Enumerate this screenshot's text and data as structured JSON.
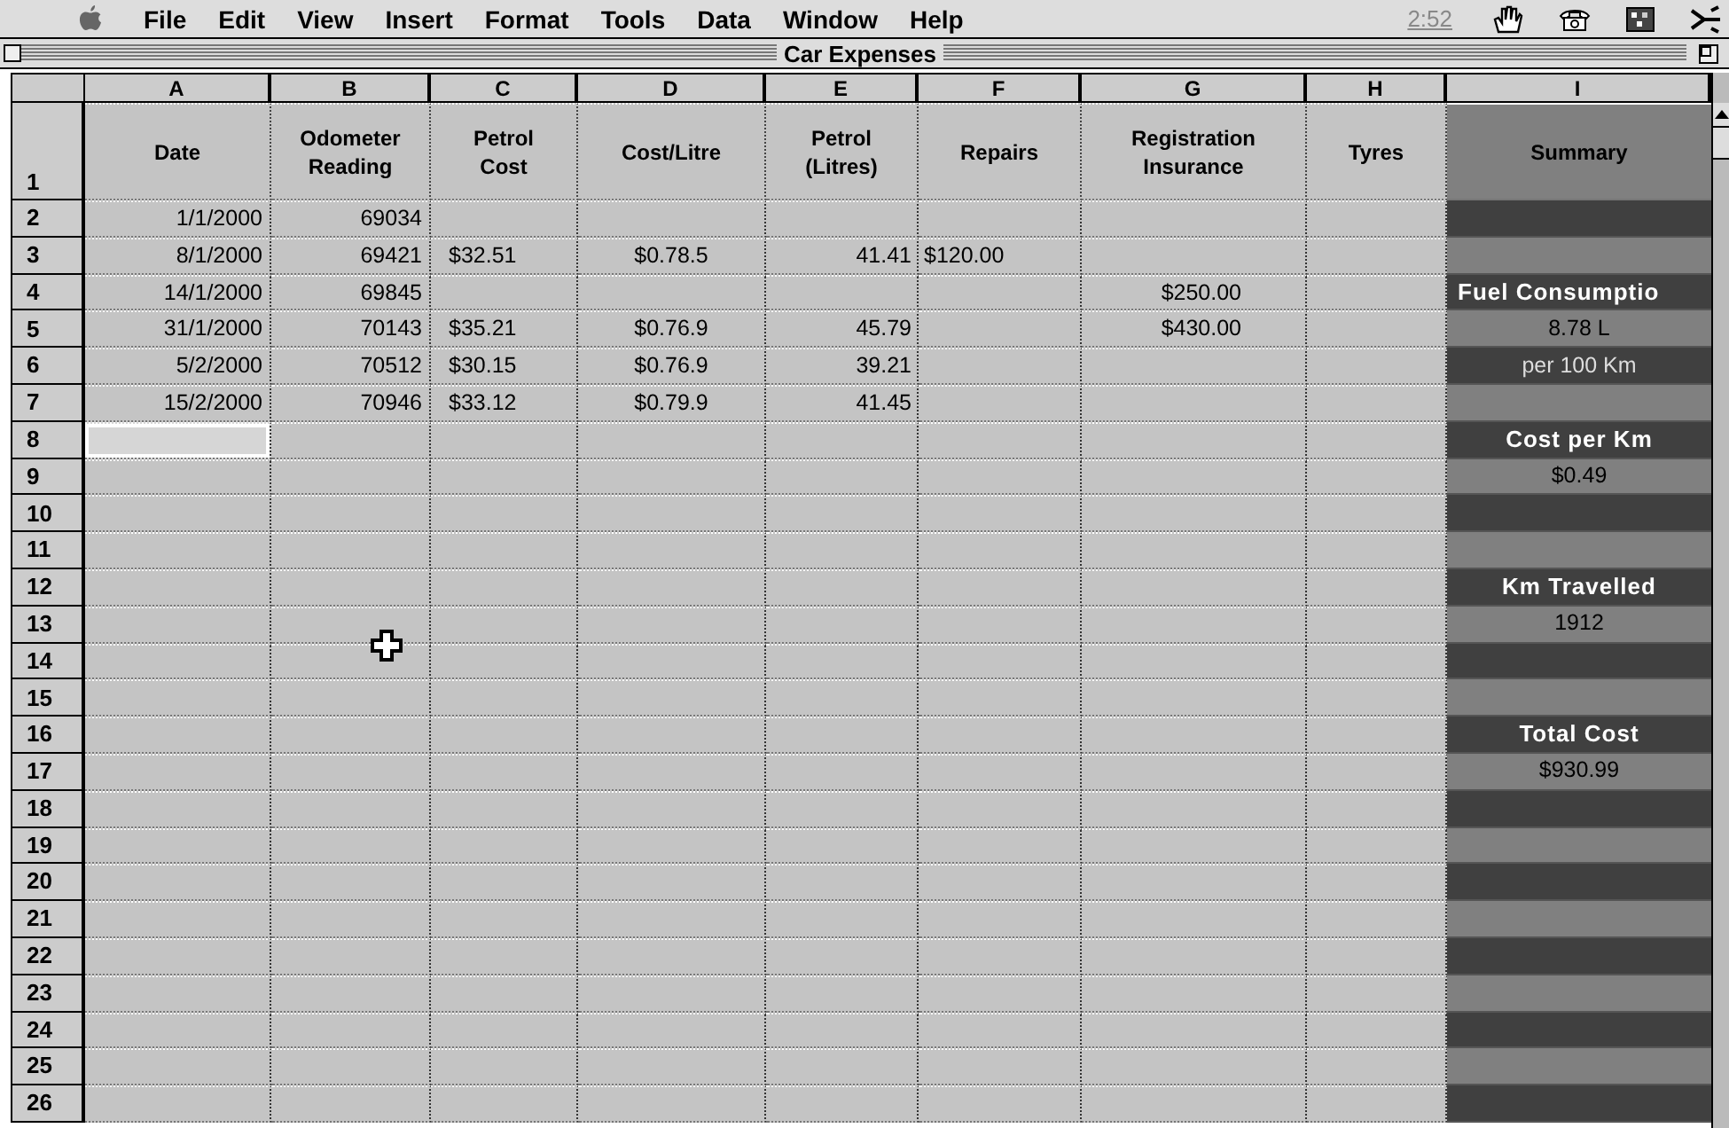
{
  "menu_bar": {
    "menus": [
      "File",
      "Edit",
      "View",
      "Insert",
      "Format",
      "Tools",
      "Data",
      "Window",
      "Help"
    ],
    "clock": "2:52"
  },
  "window": {
    "title": "Car Expenses"
  },
  "columns": [
    "A",
    "B",
    "C",
    "D",
    "E",
    "F",
    "G",
    "H",
    "I"
  ],
  "header_row": {
    "number": "1",
    "labels": [
      "Date",
      "Odometer\nReading",
      "Petrol\nCost",
      "Cost/Litre",
      "Petrol\n(Litres)",
      "Repairs",
      "Registration\nInsurance",
      "Tyres",
      "Summary"
    ]
  },
  "rows": [
    {
      "number": "2",
      "selected": false,
      "cells": [
        "1/1/2000",
        "69034"
      ]
    },
    {
      "number": "3",
      "selected": false,
      "cells": [
        "8/1/2000",
        "69421",
        "$32.51",
        "$0.78.5",
        "41.41",
        "$120.00"
      ]
    },
    {
      "number": "4",
      "selected": false,
      "cells": [
        "14/1/2000",
        "69845",
        null,
        null,
        null,
        null,
        "$250.00"
      ],
      "summary": {
        "kind": "label",
        "text": "Fuel Consumptio"
      }
    },
    {
      "number": "5",
      "selected": false,
      "cells": [
        "31/1/2000",
        "70143",
        "$35.21",
        "$0.76.9",
        "45.79",
        null,
        "$430.00"
      ],
      "summary": {
        "kind": "value",
        "text": "8.78 L"
      }
    },
    {
      "number": "6",
      "selected": false,
      "cells": [
        "5/2/2000",
        "70512",
        "$30.15",
        "$0.76.9",
        "39.21"
      ],
      "summary": {
        "kind": "note",
        "text": "per 100 Km"
      }
    },
    {
      "number": "7",
      "selected": false,
      "cells": [
        "15/2/2000",
        "70946",
        "$33.12",
        "$0.79.9",
        "41.45"
      ]
    },
    {
      "number": "8",
      "selected": true,
      "summary": {
        "kind": "label",
        "text": "Cost per Km"
      }
    },
    {
      "number": "9",
      "selected": false,
      "summary": {
        "kind": "value",
        "text": "$0.49"
      }
    },
    {
      "number": "10",
      "selected": false
    },
    {
      "number": "11",
      "selected": false
    },
    {
      "number": "12",
      "selected": false,
      "summary": {
        "kind": "label",
        "text": "Km Travelled"
      }
    },
    {
      "number": "13",
      "selected": false,
      "summary": {
        "kind": "value",
        "text": "1912"
      }
    },
    {
      "number": "14",
      "selected": false
    },
    {
      "number": "15",
      "selected": false
    },
    {
      "number": "16",
      "selected": false,
      "summary": {
        "kind": "label",
        "text": "Total Cost"
      }
    },
    {
      "number": "17",
      "selected": false,
      "summary": {
        "kind": "value",
        "text": "$930.99"
      }
    },
    {
      "number": "18",
      "selected": false
    },
    {
      "number": "19",
      "selected": false
    },
    {
      "number": "20",
      "selected": false
    },
    {
      "number": "21",
      "selected": false
    },
    {
      "number": "22",
      "selected": false
    },
    {
      "number": "23",
      "selected": false
    },
    {
      "number": "24",
      "selected": false
    },
    {
      "number": "25",
      "selected": false
    },
    {
      "number": "26",
      "selected": false
    }
  ]
}
